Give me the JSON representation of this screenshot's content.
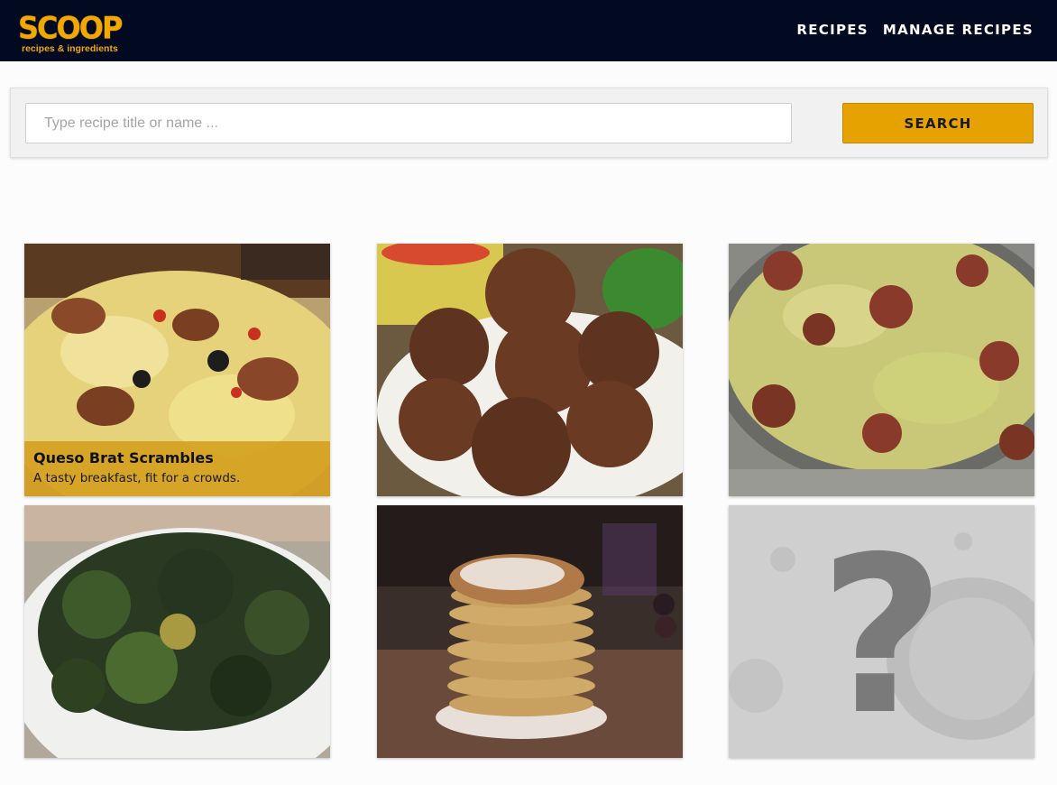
{
  "header": {
    "logo_main": "SCOOP",
    "logo_sub": "recipes & ingredients",
    "nav": [
      {
        "label": "RECIPES"
      },
      {
        "label": "MANAGE RECIPES"
      }
    ]
  },
  "search": {
    "placeholder": "Type recipe title or name ...",
    "value": "",
    "button_label": "SEARCH"
  },
  "recipes": [
    {
      "title": "Queso Brat Scrambles",
      "description": "A tasty breakfast, fit for a crowds.",
      "image": "scrambled-eggs-sausage-photo"
    },
    {
      "image": "meatballs-photo"
    },
    {
      "image": "cabbage-sausage-skillet-photo"
    },
    {
      "image": "roasted-brussels-sprouts-photo"
    },
    {
      "image": "pancake-stack-photo"
    },
    {
      "image": "question-mark-placeholder-icon"
    }
  ],
  "colors": {
    "header_bg": "#020a22",
    "accent": "#e6a200",
    "page_bg": "#fcfcfc"
  }
}
